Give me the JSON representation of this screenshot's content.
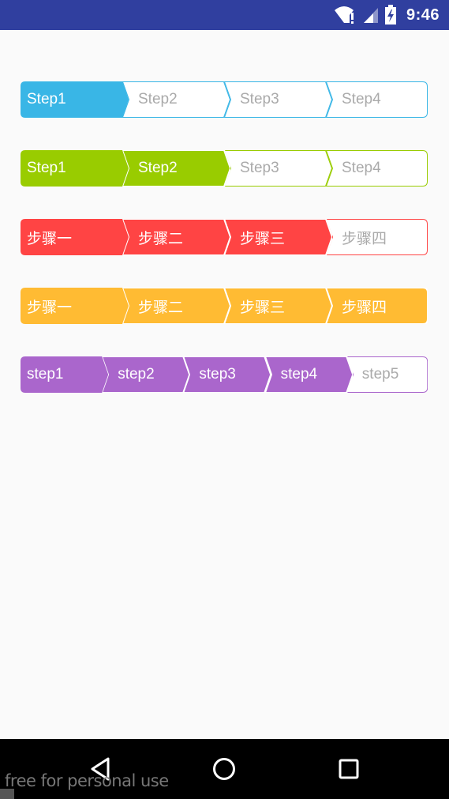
{
  "status_bar": {
    "time": "9:46",
    "wifi_icon": "wifi-alert-icon",
    "signal_icon": "signal-icon",
    "battery_icon": "battery-charging-icon"
  },
  "steppers": [
    {
      "color": "#39b6e6",
      "completed": 1,
      "steps": [
        "Step1",
        "Step2",
        "Step3",
        "Step4"
      ]
    },
    {
      "color": "#99cc00",
      "completed": 2,
      "steps": [
        "Step1",
        "Step2",
        "Step3",
        "Step4"
      ]
    },
    {
      "color": "#ff4444",
      "completed": 3,
      "steps": [
        "步骤一",
        "步骤二",
        "步骤三",
        "步骤四"
      ]
    },
    {
      "color": "#ffbb33",
      "completed": 4,
      "steps": [
        "步骤一",
        "步骤二",
        "步骤三",
        "步骤四"
      ]
    },
    {
      "color": "#aa66cc",
      "completed": 4,
      "steps": [
        "step1",
        "step2",
        "step3",
        "step4",
        "step5"
      ]
    }
  ],
  "inactive_text_color": "#aaaaaa",
  "nav_bar": {
    "back_icon": "back-triangle-icon",
    "home_icon": "home-circle-icon",
    "recents_icon": "recents-square-icon"
  },
  "watermark": {
    "text": "free for personal use"
  }
}
